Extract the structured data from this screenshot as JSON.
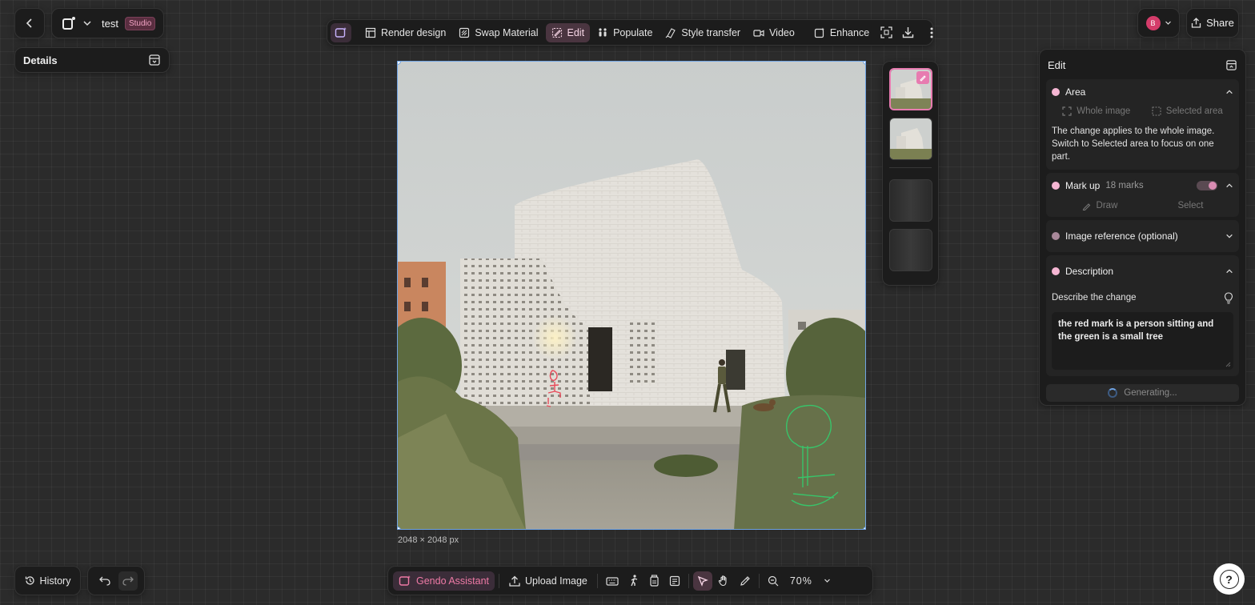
{
  "project": {
    "name": "test",
    "badge": "Studio"
  },
  "details": {
    "title": "Details"
  },
  "toolbar": {
    "items": [
      {
        "label": "Render design"
      },
      {
        "label": "Swap Material"
      },
      {
        "label": "Edit"
      },
      {
        "label": "Populate"
      },
      {
        "label": "Style transfer"
      },
      {
        "label": "Video"
      },
      {
        "label": "Enhance"
      }
    ]
  },
  "user": {
    "initial": "B"
  },
  "share": {
    "label": "Share"
  },
  "canvas": {
    "dimensions": "2048 × 2048 px"
  },
  "edit_panel": {
    "title": "Edit",
    "area": {
      "title": "Area",
      "whole_image": "Whole image",
      "selected_area": "Selected area",
      "note": "The change applies to the whole image. Switch to Selected area to focus on one part."
    },
    "markup": {
      "title": "Mark up",
      "count": "18 marks",
      "draw": "Draw",
      "select": "Select"
    },
    "image_reference": {
      "title": "Image reference (optional)"
    },
    "description": {
      "title": "Description",
      "label": "Describe the change",
      "value": "the red mark is a person sitting and the green is a small tree"
    },
    "generate": {
      "label": "Generating..."
    }
  },
  "bottom": {
    "history": "History",
    "assistant": "Gendo Assistant",
    "upload": "Upload Image",
    "zoom": "70%"
  },
  "help": {
    "label": "?"
  },
  "colors": {
    "accent": "#e77bb0",
    "selection": "#6fa3e3",
    "red_mark": "#e84a5a",
    "green_mark": "#38c46a"
  }
}
